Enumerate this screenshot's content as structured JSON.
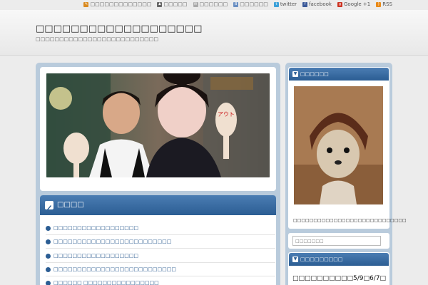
{
  "toplinks": [
    {
      "icon": "edit-icon",
      "label": "□□□□□□□□□□□□□",
      "color": "#d98a20"
    },
    {
      "icon": "person-icon",
      "label": "□□□□□",
      "color": "#666666"
    },
    {
      "icon": "mail-icon",
      "label": "□□□□□□",
      "color": "#aaaaaa"
    },
    {
      "icon": "bookmark-icon",
      "label": "□□□□□□",
      "color": "#6a8fc2"
    },
    {
      "icon": "twitter-icon",
      "label": "twitter",
      "color": "#3ba0d8"
    },
    {
      "icon": "facebook-icon",
      "label": "facebook",
      "color": "#3b5998"
    },
    {
      "icon": "google-plus-icon",
      "label": "Google +1",
      "color": "#cc3322"
    },
    {
      "icon": "rss-icon",
      "label": "RSS",
      "color": "#e98a18"
    }
  ],
  "header": {
    "title": "□□□□□□□□□□□□□□□□□□□",
    "description": "□□□□□□□□□□□□□□□□□□□□□□□□□□"
  },
  "hero": {
    "sign_text": "アウト"
  },
  "entries": {
    "title": "□□□□",
    "items": [
      "□□□□□□□□□□□□□□□□□□",
      "□□□□□□□□□□□□□□□□□□□□□□□□□",
      "□□□□□□□□□□□□□□□□□□",
      "□□□□□□□□□□□□□□□□□□□□□□□□□□",
      "□□□□□□ □□□□□□□□□□□□□□□□"
    ]
  },
  "sidebar": {
    "profile_title": "□□□□□□",
    "profile_caption": "□□□□□□□□□□□□□□□□□□□□□□□□□□□□",
    "search_placeholder": "□□□□□□□",
    "recent_title": "□□□□□□□□□",
    "recent_headline": "□□□□□□□□□□5/9□6/7□"
  },
  "colors": {
    "accent": "#2b5d93",
    "accent_light": "#4b7db3",
    "panel_bg": "#b9cbdc",
    "link": "#1a4e86"
  }
}
